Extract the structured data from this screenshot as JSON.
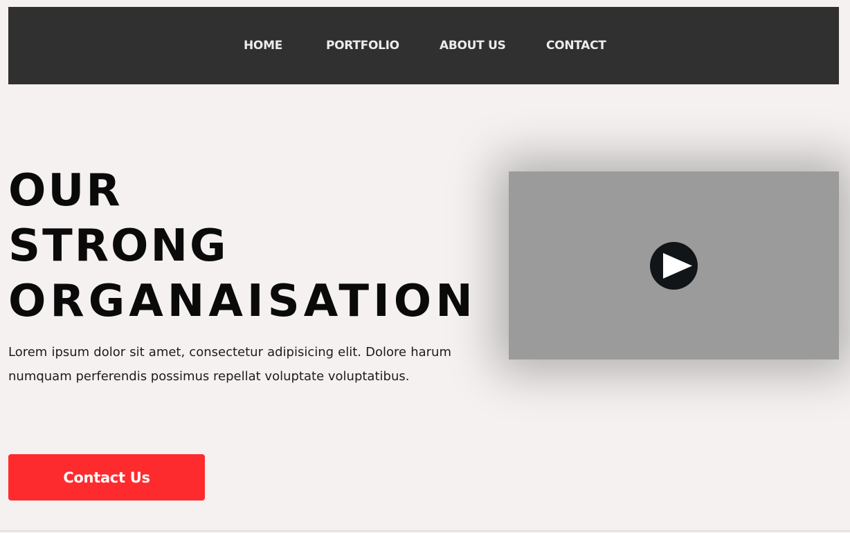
{
  "nav": {
    "items": [
      {
        "label": "HOME"
      },
      {
        "label": "PORTFOLIO"
      },
      {
        "label": "ABOUT US"
      },
      {
        "label": "CONTACT"
      }
    ]
  },
  "hero": {
    "title_lines": [
      "OUR",
      "STRONG",
      "ORGANAISATION"
    ],
    "paragraph": "Lorem ipsum dolor sit amet, consectetur adipisicing elit. Dolore harum numquam perferendis possimus repellat voluptate voluptatibus.",
    "button_label": "Contact Us"
  },
  "video": {
    "play_icon": "play-icon"
  },
  "colors": {
    "navbar_bg": "#303030",
    "page_bg": "#f4f1f0",
    "accent": "#fe2b2e",
    "video_bg": "#9b9b9b"
  }
}
